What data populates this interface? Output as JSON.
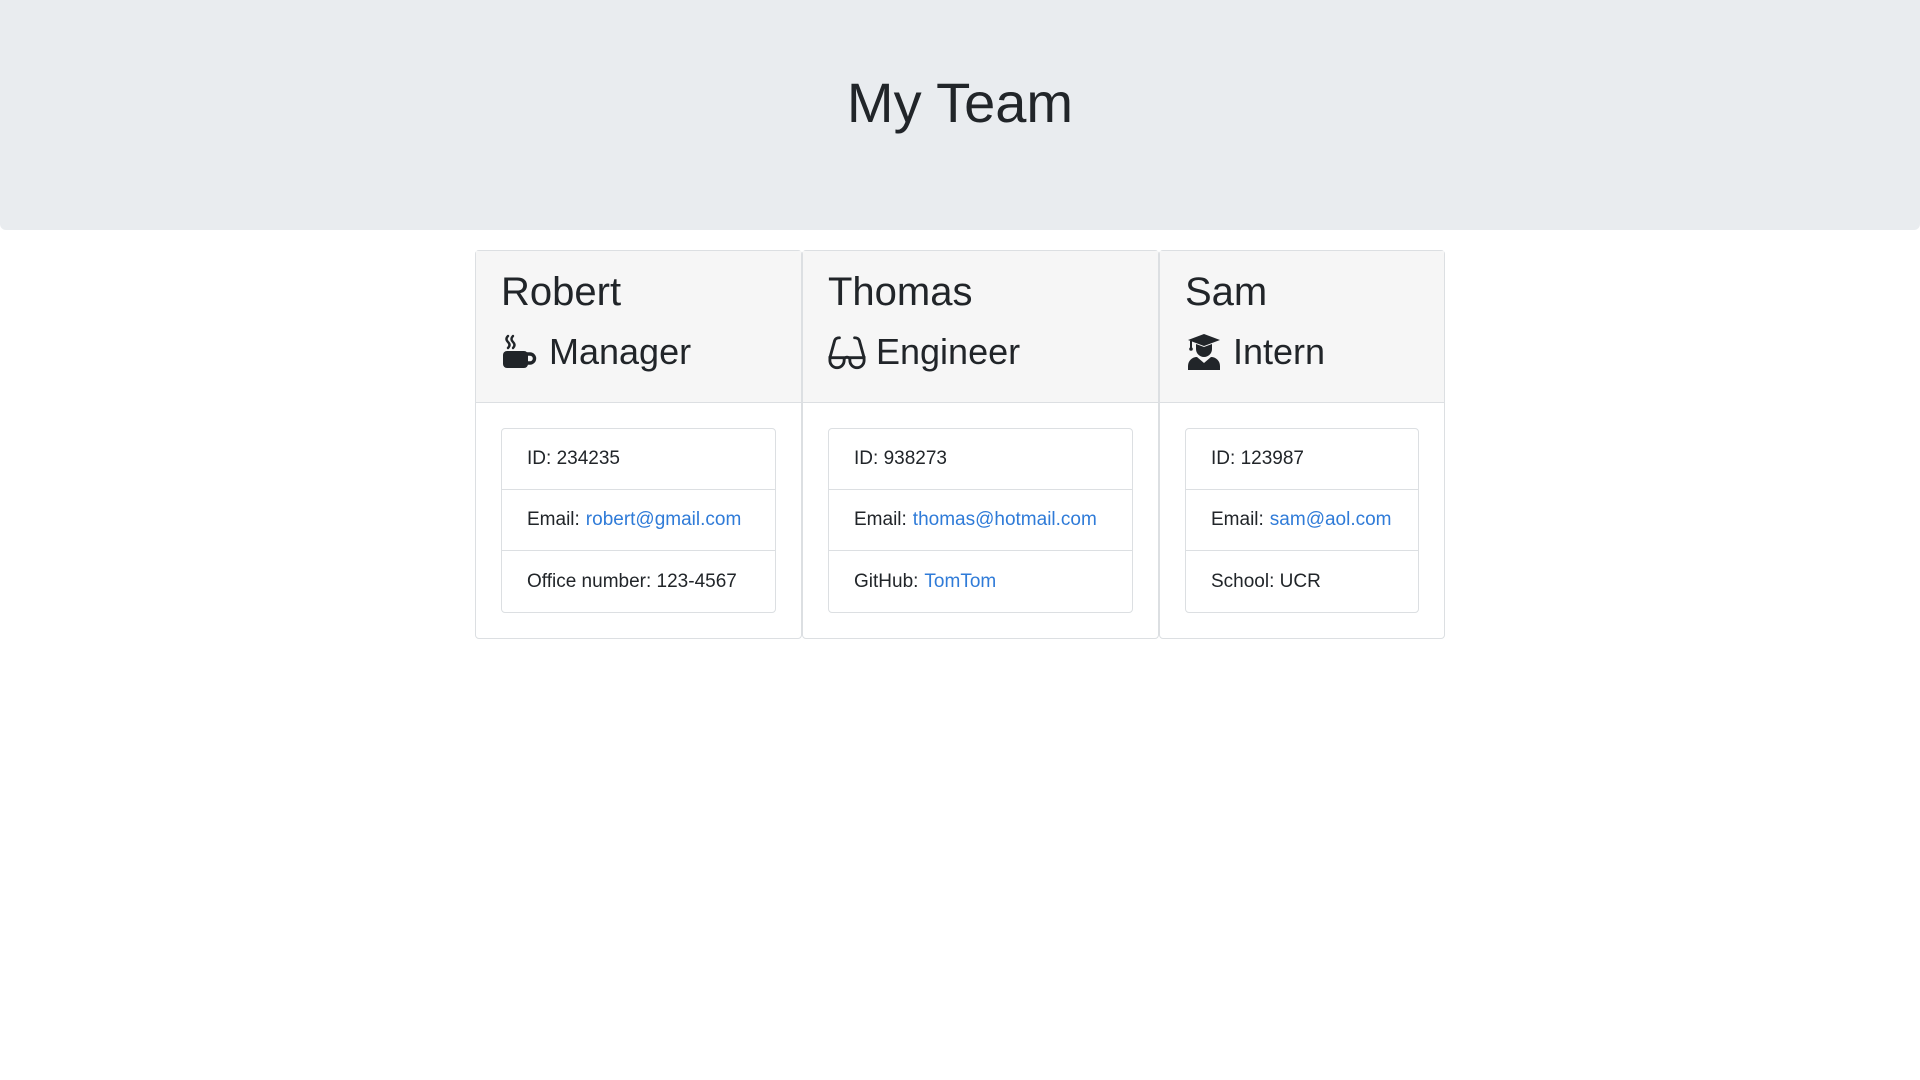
{
  "header": {
    "title": "My Team"
  },
  "team": [
    {
      "name": "Robert",
      "role": "Manager",
      "icon": "coffee-icon",
      "id_label": "ID:",
      "id": "234235",
      "email_label": "Email:",
      "email": "robert@gmail.com",
      "extra_label": "Office number:",
      "extra_value": "123-4567"
    },
    {
      "name": "Thomas",
      "role": "Engineer",
      "icon": "glasses-icon",
      "id_label": "ID:",
      "id": "938273",
      "email_label": "Email:",
      "email": "thomas@hotmail.com",
      "extra_label": "GitHub:",
      "extra_value": "TomTom"
    },
    {
      "name": "Sam",
      "role": "Intern",
      "icon": "graduate-icon",
      "id_label": "ID:",
      "id": "123987",
      "email_label": "Email:",
      "email": "sam@aol.com",
      "extra_label": "School:",
      "extra_value": "UCR"
    }
  ],
  "colors": {
    "link": "#2f7bd8",
    "jumbotron": "#e9ecef",
    "card_header": "#f6f6f6"
  }
}
